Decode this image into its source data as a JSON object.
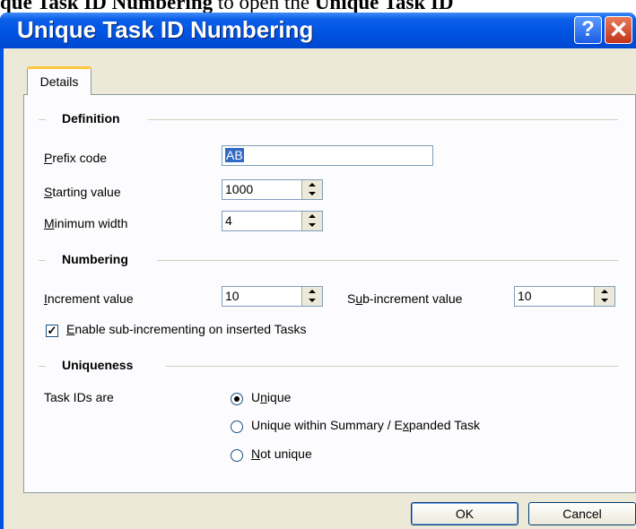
{
  "document": {
    "text_before": "que Task ID Numbering",
    "text_middle": " to open the ",
    "text_after": "Unique Task ID"
  },
  "dialog": {
    "title": "Unique Task ID Numbering",
    "help_button": "?",
    "close_button": "✕",
    "tab": "Details",
    "definition": {
      "heading": "Definition",
      "prefix_label": "Prefix code",
      "prefix_value": "AB",
      "starting_label": "Starting value",
      "starting_value": "1000",
      "minwidth_label": "Minimum width",
      "minwidth_value": "4"
    },
    "numbering": {
      "heading": "Numbering",
      "increment_label": "Increment value",
      "increment_value": "10",
      "subincrement_label": "Sub-increment value",
      "subincrement_value": "10",
      "enable_sub_label": "Enable sub-incrementing on inserted Tasks",
      "enable_sub_checked": true
    },
    "uniqueness": {
      "heading": "Uniqueness",
      "taskids_label": "Task IDs are",
      "options": [
        "Unique",
        "Unique within Summary / Expanded Task",
        "Not unique"
      ],
      "selected": "Unique"
    },
    "ok": "OK",
    "cancel": "Cancel"
  }
}
